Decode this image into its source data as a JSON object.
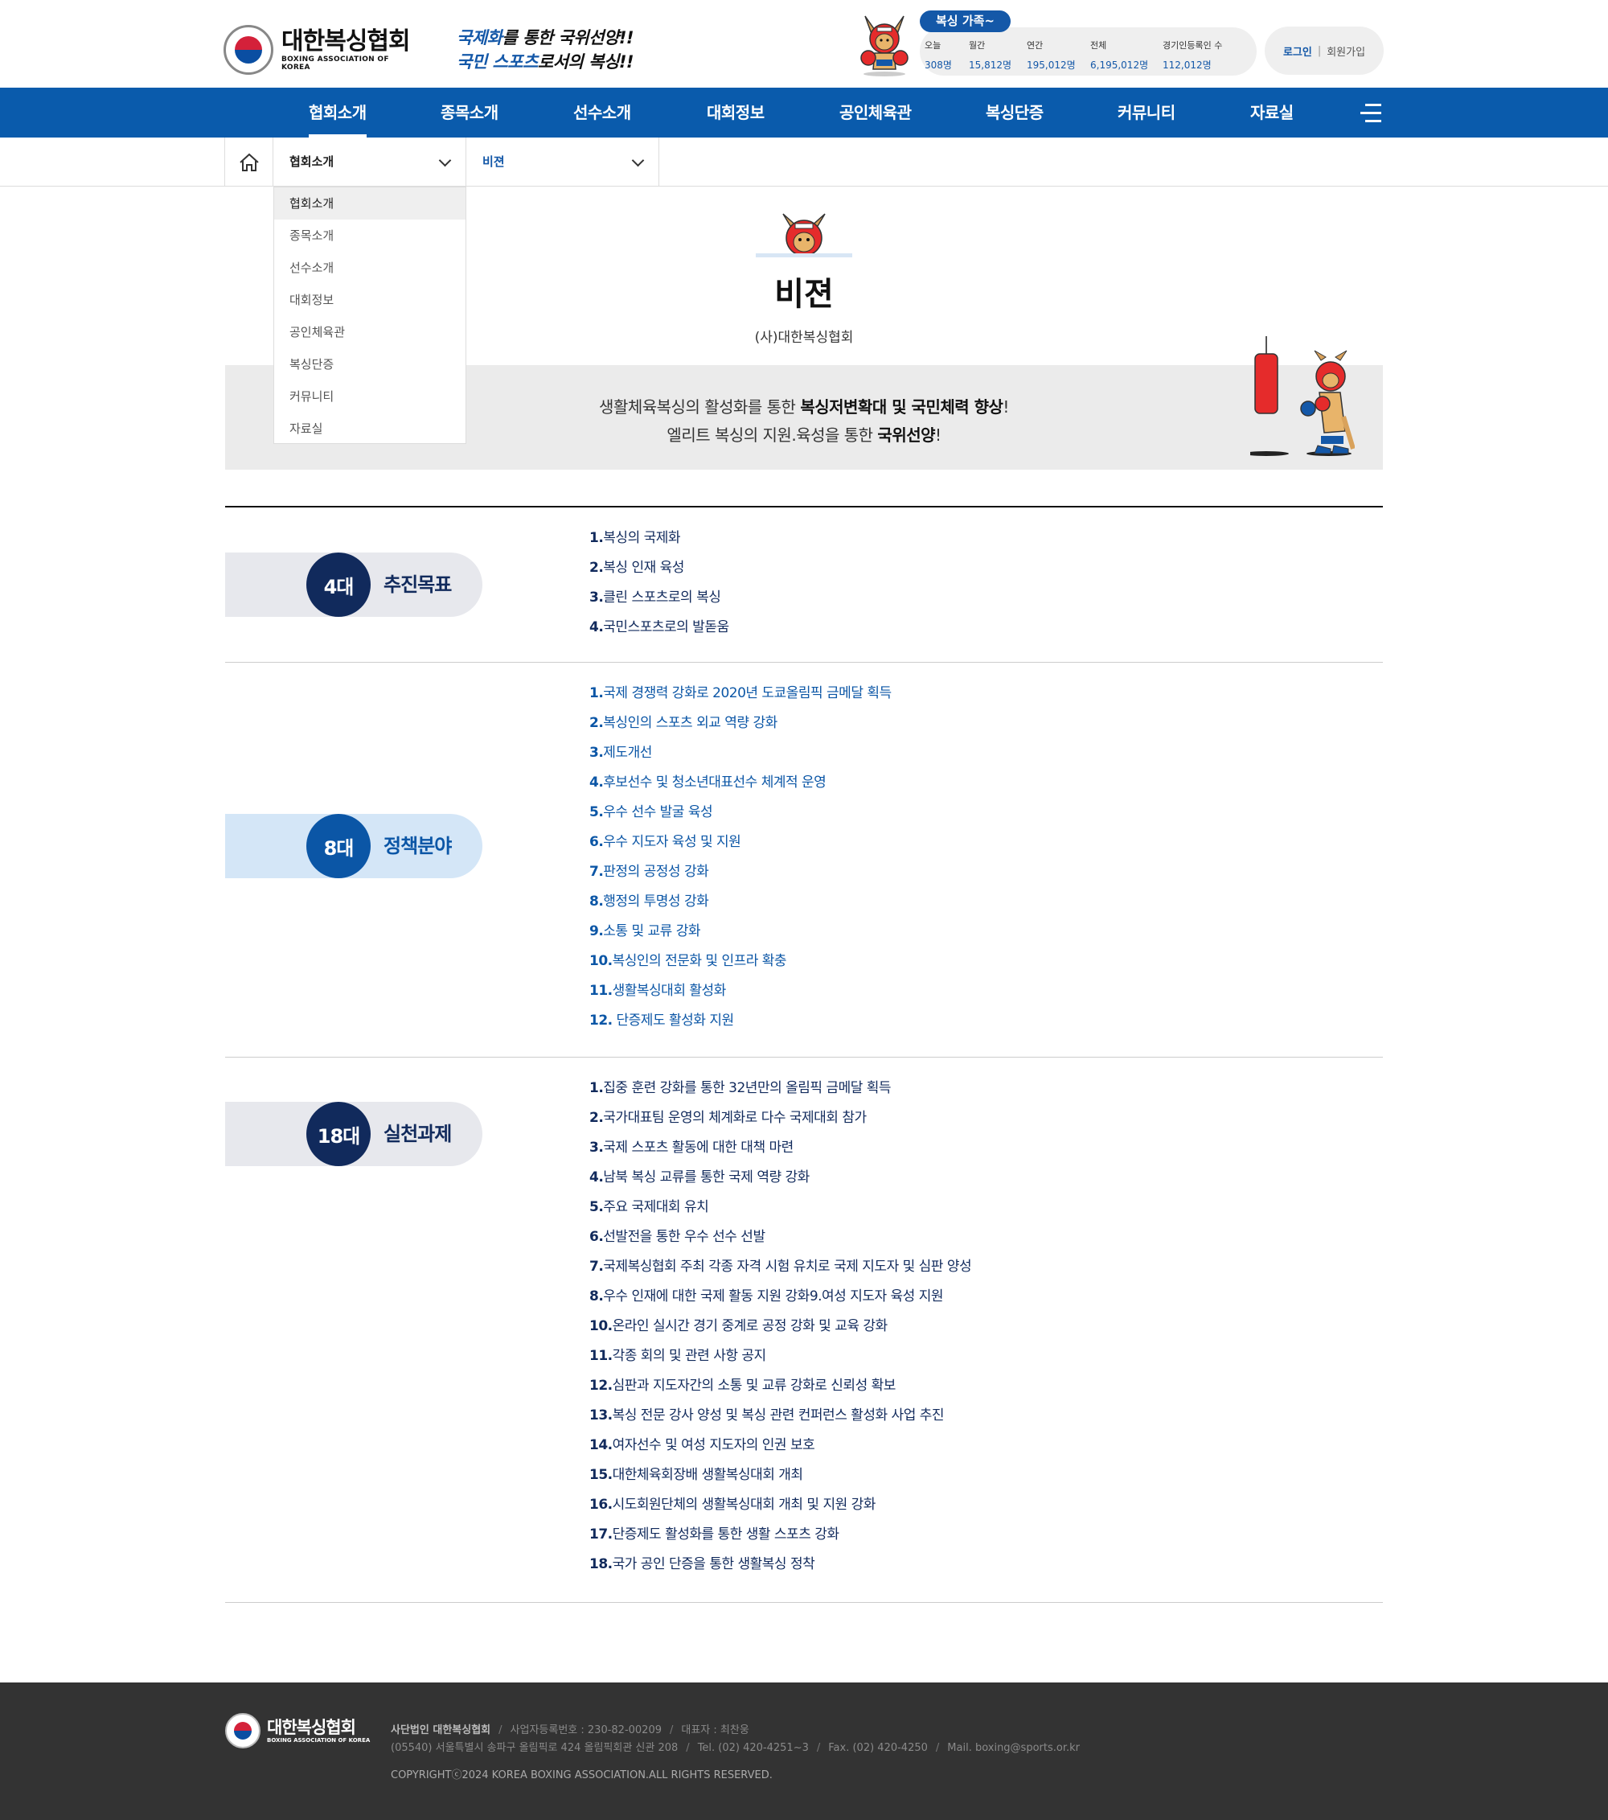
{
  "header": {
    "logo_kr": "대한복싱협회",
    "logo_en": "BOXING ASSOCIATION OF KOREA",
    "slogan_1_hl": "국제화",
    "slogan_1_rest": "를 통한 국위선양!!",
    "slogan_2_hl": "국민 스포츠",
    "slogan_2_rest": "로서의 복싱!!",
    "stats_badge": "복싱 가족~",
    "stats": [
      {
        "label": "오늘",
        "value": "308명"
      },
      {
        "label": "월간",
        "value": "15,812명"
      },
      {
        "label": "연간",
        "value": "195,012명"
      },
      {
        "label": "전체",
        "value": "6,195,012명"
      },
      {
        "label": "경기인등록인 수",
        "value": "112,012명"
      }
    ],
    "login": "로그인",
    "join": "회원가입"
  },
  "gnb": [
    "협회소개",
    "종목소개",
    "선수소개",
    "대회정보",
    "공인체육관",
    "복싱단증",
    "커뮤니티",
    "자료실"
  ],
  "subnav": {
    "depth1": "협회소개",
    "depth2": "비젼",
    "dropdown": [
      "협회소개",
      "종목소개",
      "선수소개",
      "대회정보",
      "공인체육관",
      "복싱단증",
      "커뮤니티",
      "자료실"
    ]
  },
  "page": {
    "title": "비젼",
    "subtitle": "(사)대한복싱협회",
    "vision_1_a": "생활체육복싱의 활성화를 통한 ",
    "vision_1_b": "복싱저변확대 및 국민체력 향상",
    "vision_1_c": "!",
    "vision_2_a": "엘리트 복싱의 지원.육성을 통한 ",
    "vision_2_b": "국위선양",
    "vision_2_c": "!"
  },
  "sections": [
    {
      "num": "4대",
      "label": "추진목표",
      "items": [
        {
          "n": "1.",
          "t": "복싱의 국제화"
        },
        {
          "n": "2.",
          "t": "복싱 인재 육성"
        },
        {
          "n": "3.",
          "t": "클린 스포츠로의 복싱"
        },
        {
          "n": "4.",
          "t": "국민스포츠로의 발돋움"
        }
      ]
    },
    {
      "num": "8대",
      "label": "정책분야",
      "items": [
        {
          "n": "1.",
          "t": "국제 경쟁력 강화로 2020년 도쿄올림픽 금메달 획득"
        },
        {
          "n": "2.",
          "t": "복싱인의 스포츠 외교 역량 강화"
        },
        {
          "n": "3.",
          "t": "제도개선"
        },
        {
          "n": "4.",
          "t": "후보선수 및 청소년대표선수 체계적 운영"
        },
        {
          "n": "5.",
          "t": "우수 선수 발굴 육성"
        },
        {
          "n": "6.",
          "t": "우수 지도자 육성 및 지원"
        },
        {
          "n": "7.",
          "t": "판정의 공정성 강화"
        },
        {
          "n": "8.",
          "t": "행정의 투명성 강화"
        },
        {
          "n": "9.",
          "t": "소통 및 교류 강화"
        },
        {
          "n": "10.",
          "t": "복싱인의 전문화 및 인프라 확충"
        },
        {
          "n": "11.",
          "t": "생활복싱대회 활성화"
        },
        {
          "n": "12.",
          "t": " 단증제도 활성화 지원"
        }
      ]
    },
    {
      "num": "18대",
      "label": "실천과제",
      "items": [
        {
          "n": "1.",
          "t": "집중 훈련 강화를 통한 32년만의 올림픽 금메달 획득"
        },
        {
          "n": "2.",
          "t": "국가대표팀 운영의 체계화로 다수 국제대회 참가"
        },
        {
          "n": "3.",
          "t": "국제 스포츠 활동에 대한 대책 마련"
        },
        {
          "n": "4.",
          "t": "남북 복싱 교류를 통한 국제 역량 강화"
        },
        {
          "n": "5.",
          "t": "주요 국제대회 유치"
        },
        {
          "n": "6.",
          "t": "선발전을 통한 우수 선수 선발"
        },
        {
          "n": "7.",
          "t": "국제복싱협회 주최 각종 자격 시험 유치로 국제 지도자 및 심판 양성"
        },
        {
          "n": "8.",
          "t": "우수 인재에 대한 국제 활동 지원 강화9.여성 지도자 육성 지원"
        },
        {
          "n": "10.",
          "t": "온라인 실시간 경기 중계로 공정 강화 및 교육 강화"
        },
        {
          "n": "11.",
          "t": "각종 회의 및 관련 사항 공지"
        },
        {
          "n": "12.",
          "t": "심판과 지도자간의 소통 및 교류 강화로 신뢰성 확보"
        },
        {
          "n": "13.",
          "t": "복싱 전문 강사 양성 및 복싱 관련 컨퍼런스 활성화 사업 추진"
        },
        {
          "n": "14.",
          "t": "여자선수 및 여성 지도자의 인권 보호"
        },
        {
          "n": "15.",
          "t": "대한체육회장배 생활복싱대회 개최"
        },
        {
          "n": "16.",
          "t": "시도회원단체의 생활복싱대회 개최 및 지원 강화"
        },
        {
          "n": "17.",
          "t": "단증제도 활성화를 통한 생활 스포츠 강화"
        },
        {
          "n": "18.",
          "t": "국가 공인 단증을 통한 생활복싱 정착"
        }
      ]
    }
  ],
  "footer": {
    "logo_kr": "대한복싱협회",
    "logo_en": "BOXING ASSOCIATION OF KOREA",
    "org": "사단법인 대한복싱협회",
    "bizno": "사업자등록번호 : 230-82-00209",
    "ceo": "대표자 : 최찬웅",
    "address": "(05540) 서울특별시 송파구 올림픽로 424 올림픽회관 신관 208",
    "tel": "Tel. (02) 420-4251~3",
    "fax": "Fax. (02) 420-4250",
    "mail": "Mail. boxing@sports.or.kr",
    "copyright": "COPYRIGHTⓒ2024 KOREA BOXING ASSOCIATION.ALL RIGHTS RESERVED."
  },
  "colors": {
    "primary": "#0a5bac",
    "navy": "#112a5c",
    "footer_bg": "#333333"
  }
}
